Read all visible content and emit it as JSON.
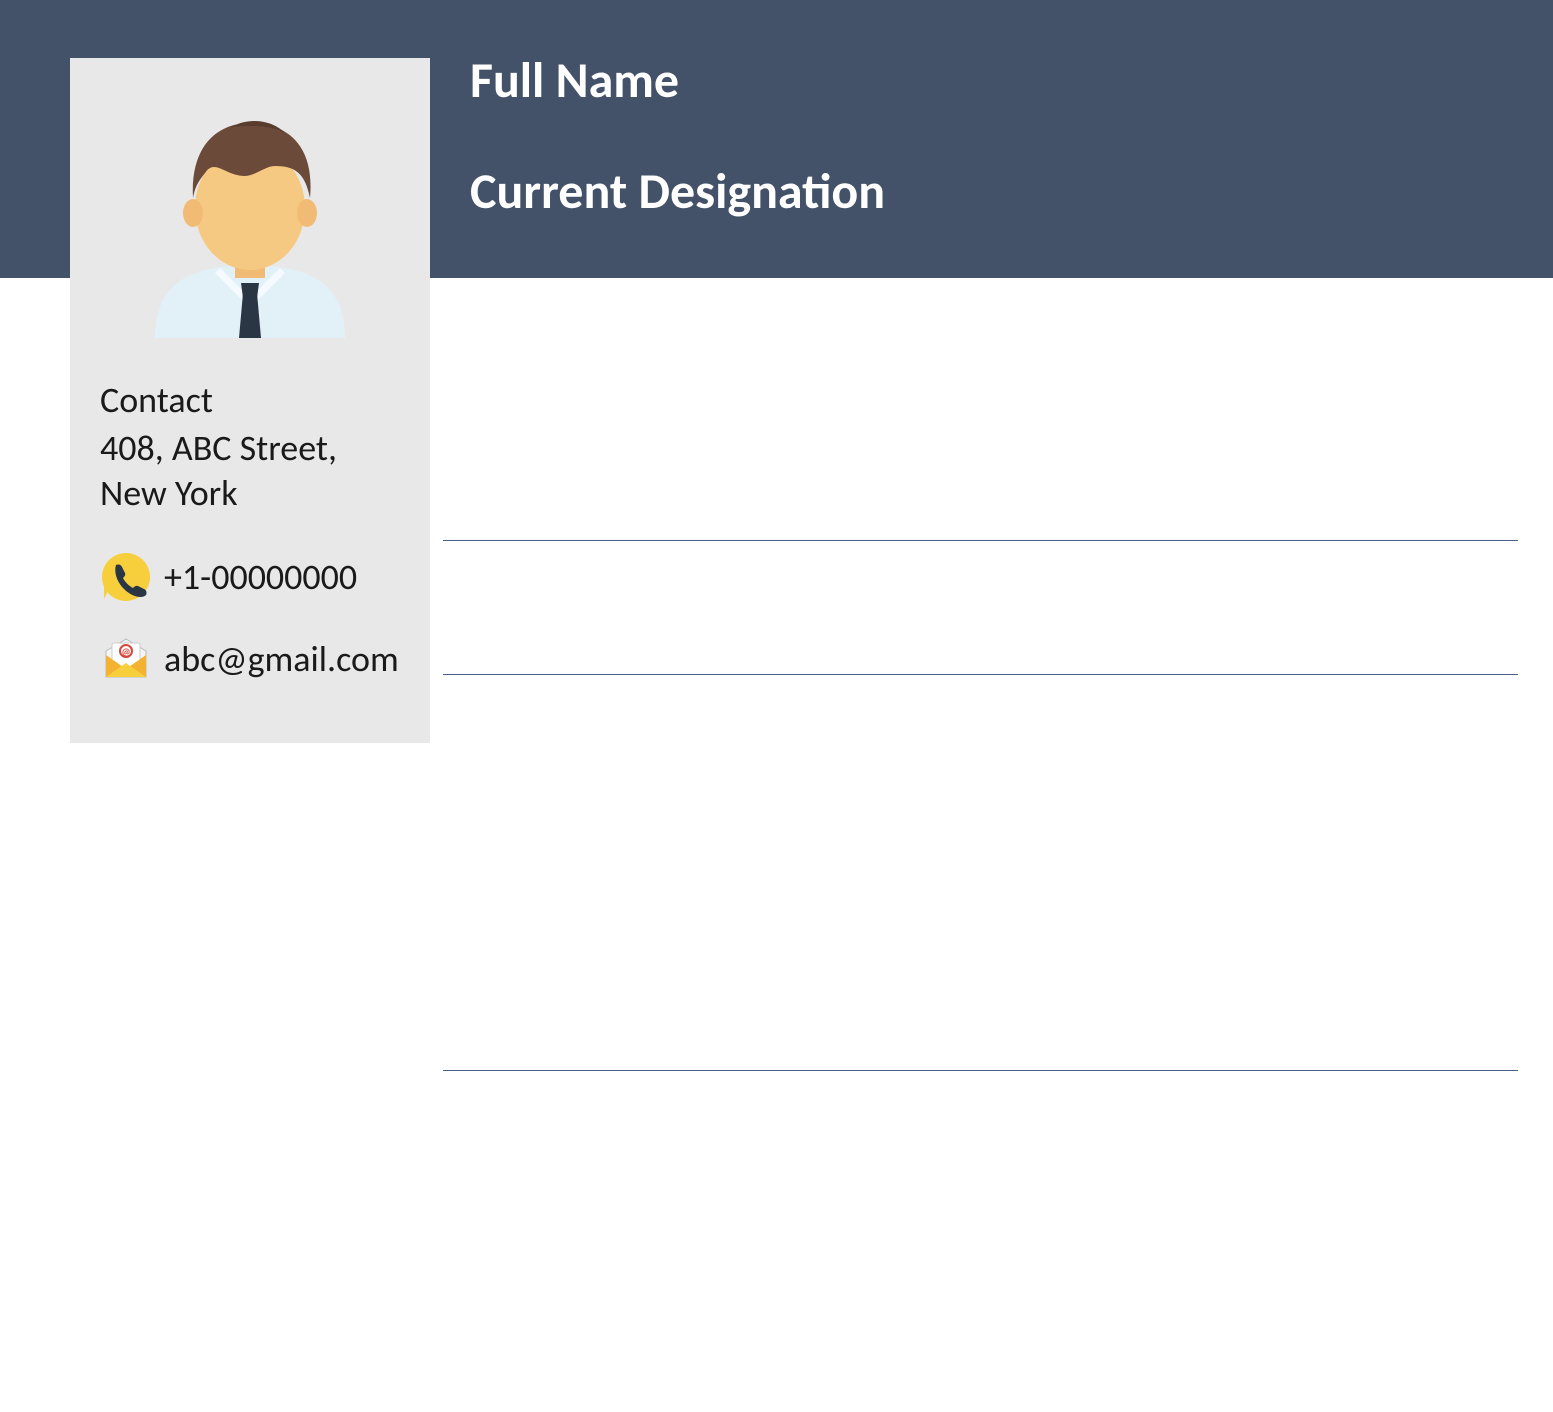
{
  "header": {
    "full_name": "Full Name",
    "designation": "Current Designation"
  },
  "sidebar": {
    "contact_heading": "Contact",
    "address_line1": "408, ABC Street,",
    "address_line2": "New York",
    "phone": "+1-00000000",
    "email": "abc@gmail.com"
  }
}
